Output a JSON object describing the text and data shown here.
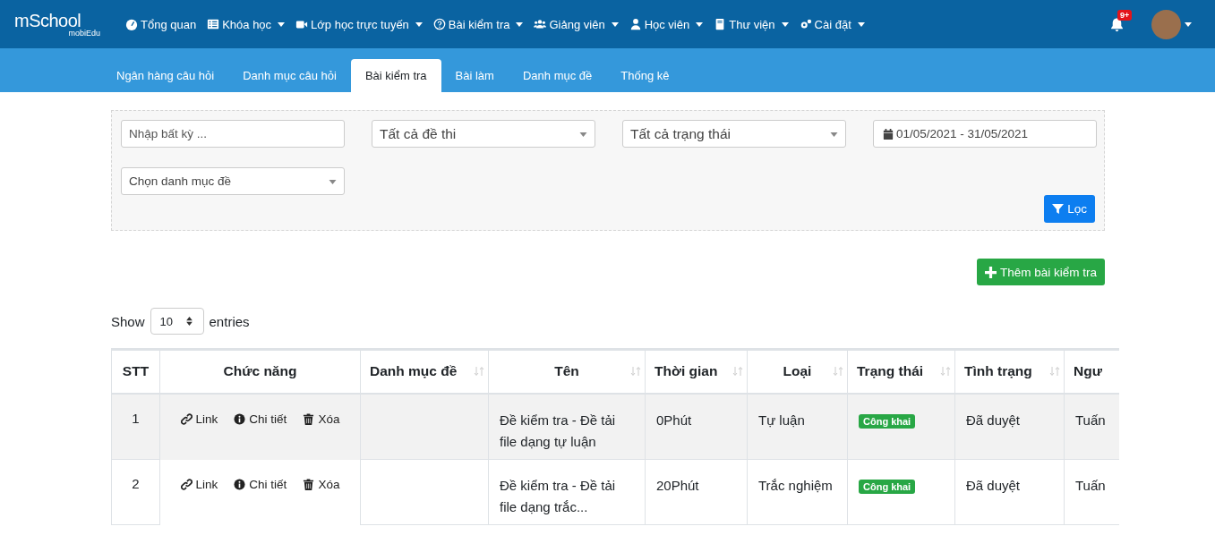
{
  "logo": {
    "main": "mSchool",
    "sub": "mobiEdu"
  },
  "nav": [
    {
      "label": "Tổng quan",
      "dropdown": false
    },
    {
      "label": "Khóa học",
      "dropdown": true
    },
    {
      "label": "Lớp học trực tuyến",
      "dropdown": true
    },
    {
      "label": "Bài kiểm tra",
      "dropdown": true
    },
    {
      "label": "Giảng viên",
      "dropdown": true
    },
    {
      "label": "Học viên",
      "dropdown": true
    },
    {
      "label": "Thư viện",
      "dropdown": true
    },
    {
      "label": "Cài đặt",
      "dropdown": true
    }
  ],
  "notifications": {
    "badge": "9+"
  },
  "tabs": [
    {
      "label": "Ngân hàng câu hỏi",
      "selected": false
    },
    {
      "label": "Danh mục câu hỏi",
      "selected": false
    },
    {
      "label": "Bài kiểm tra",
      "selected": true
    },
    {
      "label": "Bài làm",
      "selected": false
    },
    {
      "label": "Danh mục đề",
      "selected": false
    },
    {
      "label": "Thống kê",
      "selected": false
    }
  ],
  "filters": {
    "search": {
      "placeholder": "Nhập bất kỳ ..."
    },
    "exam": "Tất cả đề thi",
    "status": "Tất cả trạng thái",
    "date_range": "01/05/2021 - 31/05/2021",
    "category": "Chọn danh mục đề",
    "filter_button": "Lọc"
  },
  "add_button": "Thêm bài kiểm tra",
  "length": {
    "show": "Show",
    "value": "10",
    "entries": "entries"
  },
  "table": {
    "columns": [
      {
        "label": "STT",
        "sortable": false
      },
      {
        "label": "Chức năng",
        "sortable": false
      },
      {
        "label": "Danh mục đề",
        "sortable": true
      },
      {
        "label": "Tên",
        "sortable": true
      },
      {
        "label": "Thời gian",
        "sortable": true
      },
      {
        "label": "Loại",
        "sortable": true
      },
      {
        "label": "Trạng thái",
        "sortable": true
      },
      {
        "label": "Tình trạng",
        "sortable": true
      },
      {
        "label": "Ngư",
        "sortable": false
      }
    ],
    "rows": [
      {
        "stt": "1",
        "actions": [
          "Link",
          "Chi tiết",
          "Xóa"
        ],
        "category": "",
        "name": "Đề kiểm tra - Đề tải file dạng tự luận",
        "time": "0Phút",
        "type": "Tự luận",
        "status": "Công khai",
        "approval": "Đã duyệt",
        "creator": "Tuấn"
      },
      {
        "stt": "2",
        "actions": [
          "Link",
          "Chi tiết",
          "Xóa"
        ],
        "category": "",
        "name": "Đề kiểm tra - Đề tải file dạng trắc...",
        "time": "20Phút",
        "type": "Trắc nghiệm",
        "status": "Công khai",
        "approval": "Đã duyệt",
        "creator": "Tuấn"
      }
    ]
  }
}
